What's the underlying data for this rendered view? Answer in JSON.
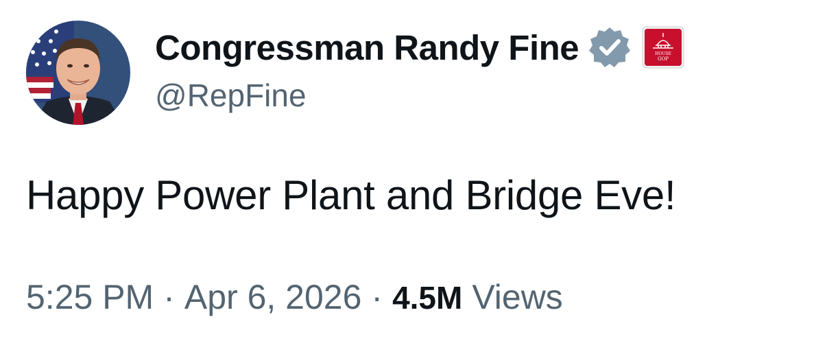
{
  "author": {
    "display_name": "Congressman Randy Fine",
    "handle": "@RepFine",
    "avatar_icon": "profile-photo",
    "verified_icon": "verified-badge-icon",
    "verified_color": "#829aab",
    "affiliation_badge_text": "HOUSE GOP",
    "affiliation_badge_color": "#c8102e"
  },
  "tweet": {
    "text": "Happy Power Plant and Bridge Eve!"
  },
  "meta": {
    "time": "5:25 PM",
    "separator": "·",
    "date": "Apr 6, 2026",
    "views_count": "4.5M",
    "views_label": "Views"
  }
}
